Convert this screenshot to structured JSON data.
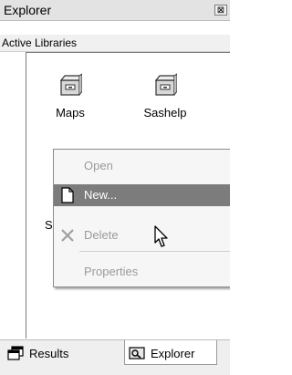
{
  "window": {
    "title": "Explorer",
    "close_glyph": "⊠"
  },
  "subheader": {
    "label": "Active Libraries"
  },
  "libraries": [
    {
      "name": "Maps",
      "icon": "file-cabinet-icon"
    },
    {
      "name": "Sashelp",
      "icon": "file-cabinet-icon"
    }
  ],
  "partial_label": "S",
  "context_menu": {
    "items": [
      {
        "label": "Open",
        "state": "disabled"
      },
      {
        "label": "New...",
        "state": "highlighted",
        "icon": "new-document-icon"
      },
      {
        "label": "Delete",
        "state": "disabled",
        "icon": "delete-x-icon"
      },
      {
        "label": "Properties",
        "state": "disabled"
      }
    ]
  },
  "tabs": [
    {
      "label": "Results",
      "icon": "results-window-icon",
      "active": false
    },
    {
      "label": "Explorer",
      "icon": "explorer-icon",
      "active": true
    }
  ],
  "colors": {
    "highlight": "#7c7c7c",
    "menu_bg": "#f6f6f6",
    "disabled_text": "#9a9a9a"
  }
}
